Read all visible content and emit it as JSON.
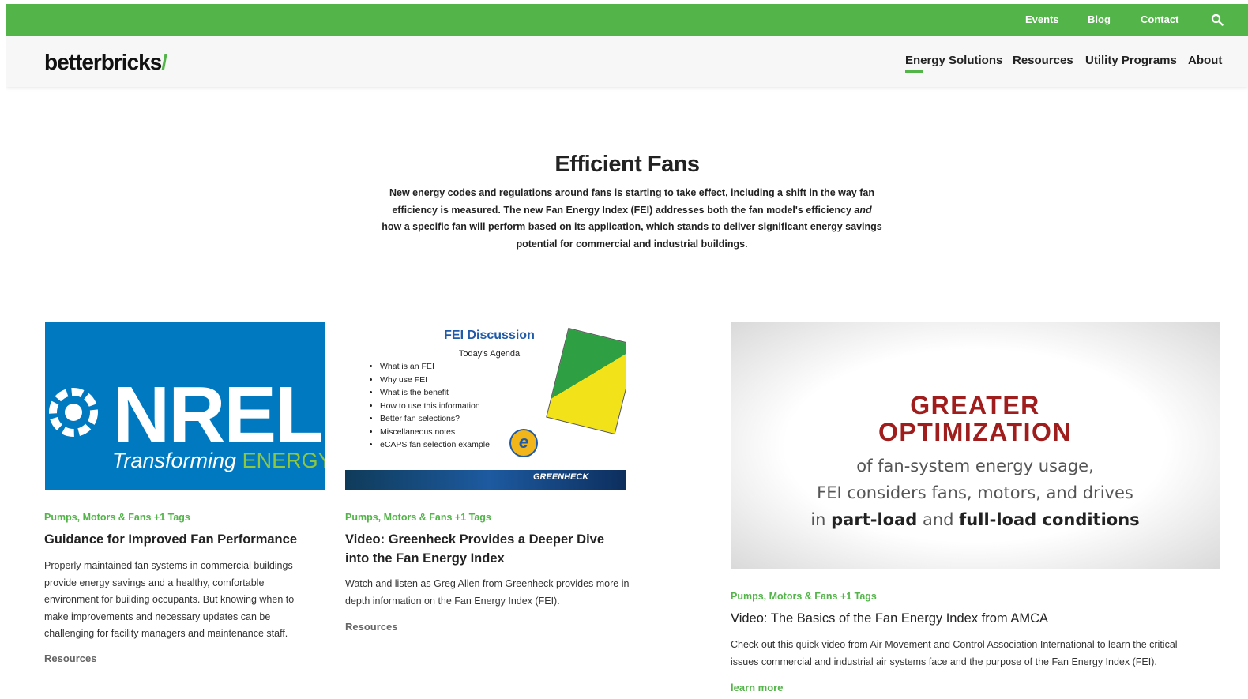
{
  "topbar": {
    "events": "Events",
    "blog": "Blog",
    "contact": "Contact",
    "search_icon": "search-icon"
  },
  "header": {
    "logo": "betterbricks",
    "logo_slash": "/",
    "nav": [
      "Energy Solutions",
      "Resources",
      "Utility Programs",
      "About"
    ],
    "active_nav": "Energy Solutions"
  },
  "hero": {
    "title": "Efficient Fans",
    "intro_a": "New energy codes and regulations around fans is starting to take effect, including a shift in the way fan efficiency is measured. The new Fan Energy Index (FEI) addresses both the fan model's efficiency ",
    "intro_em": "and",
    "intro_b": " how a specific fan will perform based on its application, which stands to deliver significant energy savings potential for commercial and industrial buildings."
  },
  "cards": [
    {
      "tag": "Pumps, Motors & Fans +1 Tags",
      "title": "Guidance for Improved Fan Performance",
      "desc": "Properly maintained fan systems in commercial buildings provide energy savings and a healthy, comfortable environment for building occupants. But knowing when to make improvements and necessary updates can be challenging for facility managers and maintenance staff.",
      "category": "Resources",
      "thumb": {
        "word": "NREL",
        "sub": "Transforming",
        "sub_b": "ENERGY"
      }
    },
    {
      "tag": "Pumps, Motors & Fans +1 Tags",
      "title": "Video: Greenheck Provides a Deeper Dive into the Fan Energy Index",
      "desc": "Watch and listen as Greg Allen from Greenheck provides more in-depth information on the Fan Energy Index (FEI).",
      "category": "Resources",
      "thumb": {
        "title": "FEI Discussion",
        "agenda": "Today's Agenda",
        "items": [
          "What is an FEI",
          "Why use FEI",
          "What is the benefit",
          "How to use this information",
          "Better fan selections?",
          "Miscellaneous notes",
          "eCAPS fan selection example"
        ],
        "brand": "GREENHECK",
        "badge": "e"
      }
    },
    {
      "tag": "Pumps, Motors & Fans +1 Tags",
      "title": "Video: The Basics of the Fan Energy Index from AMCA",
      "desc": "Check out this quick video from Air Movement and Control Association International to learn the critical issues commercial and industrial air systems face and the purpose of the Fan Energy Index (FEI).",
      "more": "learn more",
      "thumb": {
        "line1": "GREATER",
        "line2": "OPTIMIZATION",
        "line3": "of fan-system energy usage,",
        "line4": "FEI considers fans, motors, and drives",
        "line5a": "in ",
        "line5b": "part-load",
        "line5c": " and ",
        "line5d": "full-load conditions"
      }
    }
  ],
  "colors": {
    "accent": "#53b549",
    "text": "#222222",
    "nrel_blue": "#0079c1",
    "video_red": "#9f1d1d"
  }
}
